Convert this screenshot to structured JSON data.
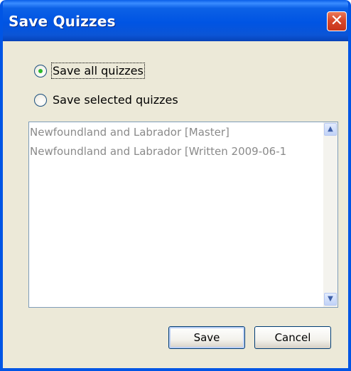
{
  "window": {
    "title": "Save Quizzes",
    "close_glyph": "✕"
  },
  "options": {
    "save_all_label": "Save all quizzes",
    "save_selected_label": "Save selected quizzes",
    "selected": "save_all"
  },
  "quiz_list": {
    "items": [
      "Newfoundland and Labrador [Master]",
      "Newfoundland and Labrador [Written 2009-06-1"
    ],
    "scroll_up_glyph": "▲",
    "scroll_down_glyph": "▼"
  },
  "buttons": {
    "save_label": "Save",
    "cancel_label": "Cancel"
  },
  "colors": {
    "titlebar": "#0054e3",
    "dialog_bg": "#ece9d8",
    "close_button": "#d8482a",
    "radio_dot": "#2cb82c",
    "list_text_disabled": "#8a8a8a"
  }
}
